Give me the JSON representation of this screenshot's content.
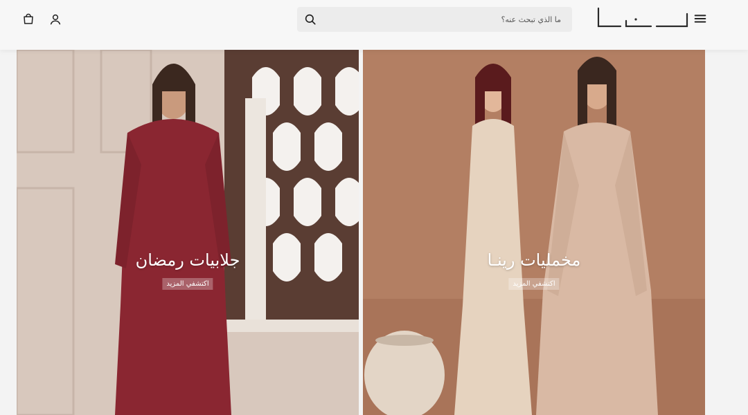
{
  "header": {
    "brand_logo_text": "رينا",
    "search": {
      "placeholder": "ما الذي تبحث عنه؟",
      "value": ""
    }
  },
  "banners": [
    {
      "title": "جلابيات رمضان",
      "cta_label": "اكتشفي المزيد",
      "garment_color": "#8a2631"
    },
    {
      "title": "مخمليات رينـا",
      "cta_label": "اكتشفي المزيد",
      "garment_color": "#d9b9a4"
    }
  ],
  "icons": {
    "cart": "shopping-bag-icon",
    "account": "user-icon",
    "search": "search-icon",
    "menu": "hamburger-menu-icon"
  },
  "colors": {
    "header_bg": "#f7f7f7",
    "search_bg": "#ececec",
    "text": "#222222"
  }
}
